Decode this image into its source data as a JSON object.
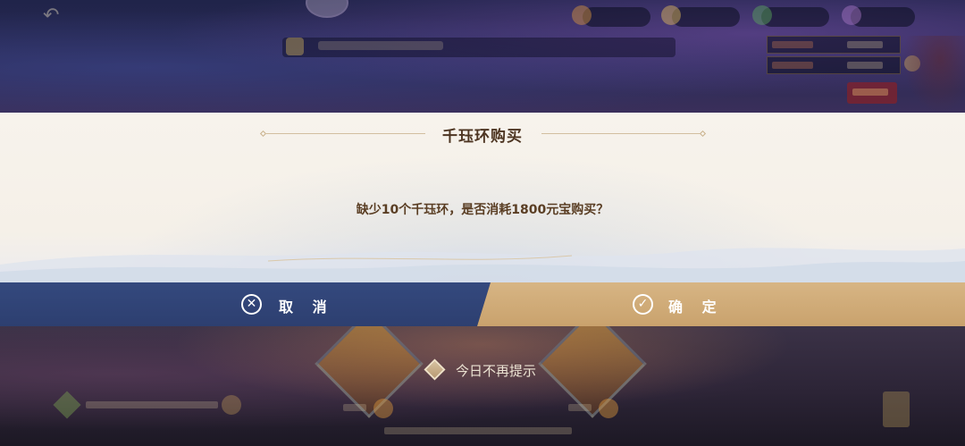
{
  "dialog": {
    "title": "千珏环购买",
    "message": "缺少10个千珏环，是否消耗1800元宝购买？"
  },
  "buttons": {
    "cancel_label": "取 消",
    "confirm_label": "确 定"
  },
  "checkbox": {
    "label": "今日不再提示",
    "checked": false
  },
  "colors": {
    "cancel_bg": "#2f4274",
    "confirm_bg": "#d0ab78",
    "dialog_bg": "#f6f1ea",
    "title_text": "#4d3522"
  },
  "icons": {
    "cancel": "close-circle-icon",
    "confirm": "check-circle-icon",
    "checkbox": "diamond-checkbox-icon"
  }
}
